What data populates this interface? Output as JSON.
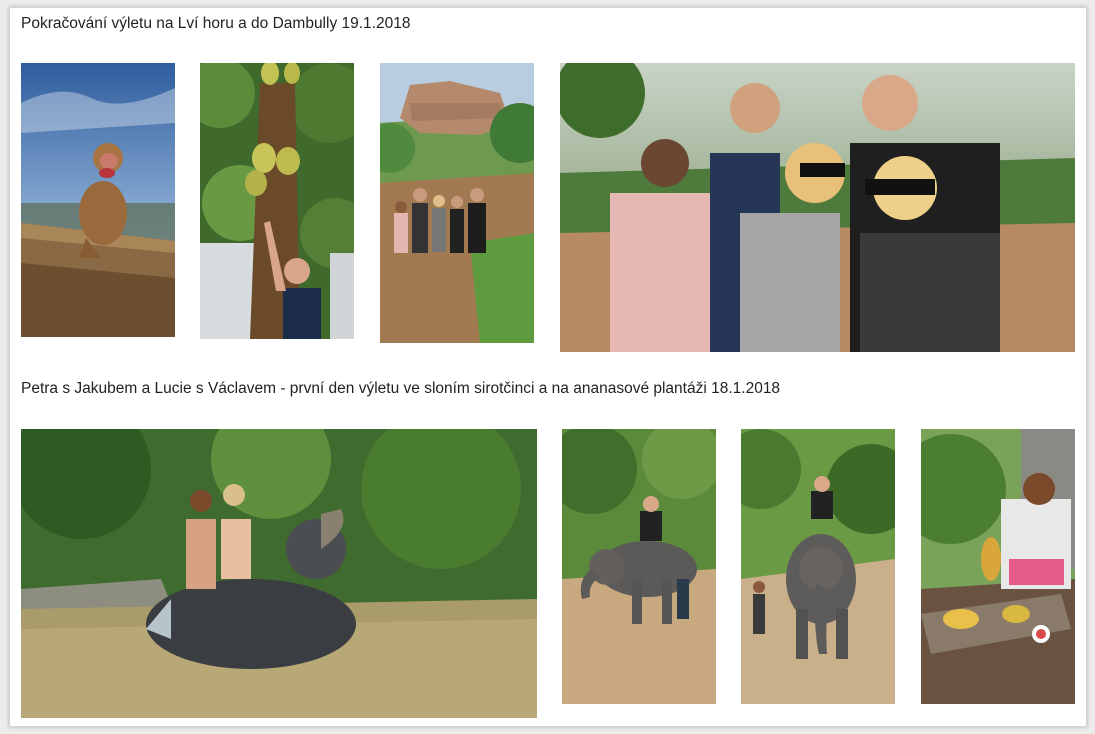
{
  "gallery": {
    "sections": [
      {
        "caption": "Pokračování výletu na Lví horu a do Dambully 19.1.2018",
        "photos": [
          "monkey-photo",
          "jackfruit-tree-photo",
          "lion-rock-group-photo",
          "group-selfie-photo"
        ]
      },
      {
        "caption": "Petra s Jakubem a Lucie s Václavem - první den výletu ve sloním sirotčinci a na ananasové plantáži 18.1.2018",
        "photos": [
          "elephant-bath-photo",
          "elephant-ride-photo",
          "elephant-walk-photo",
          "pineapple-stall-photo"
        ]
      }
    ]
  },
  "colors": {
    "panel_bg": "#ffffff",
    "page_bg": "#ececec",
    "caption_text": "#222222"
  }
}
